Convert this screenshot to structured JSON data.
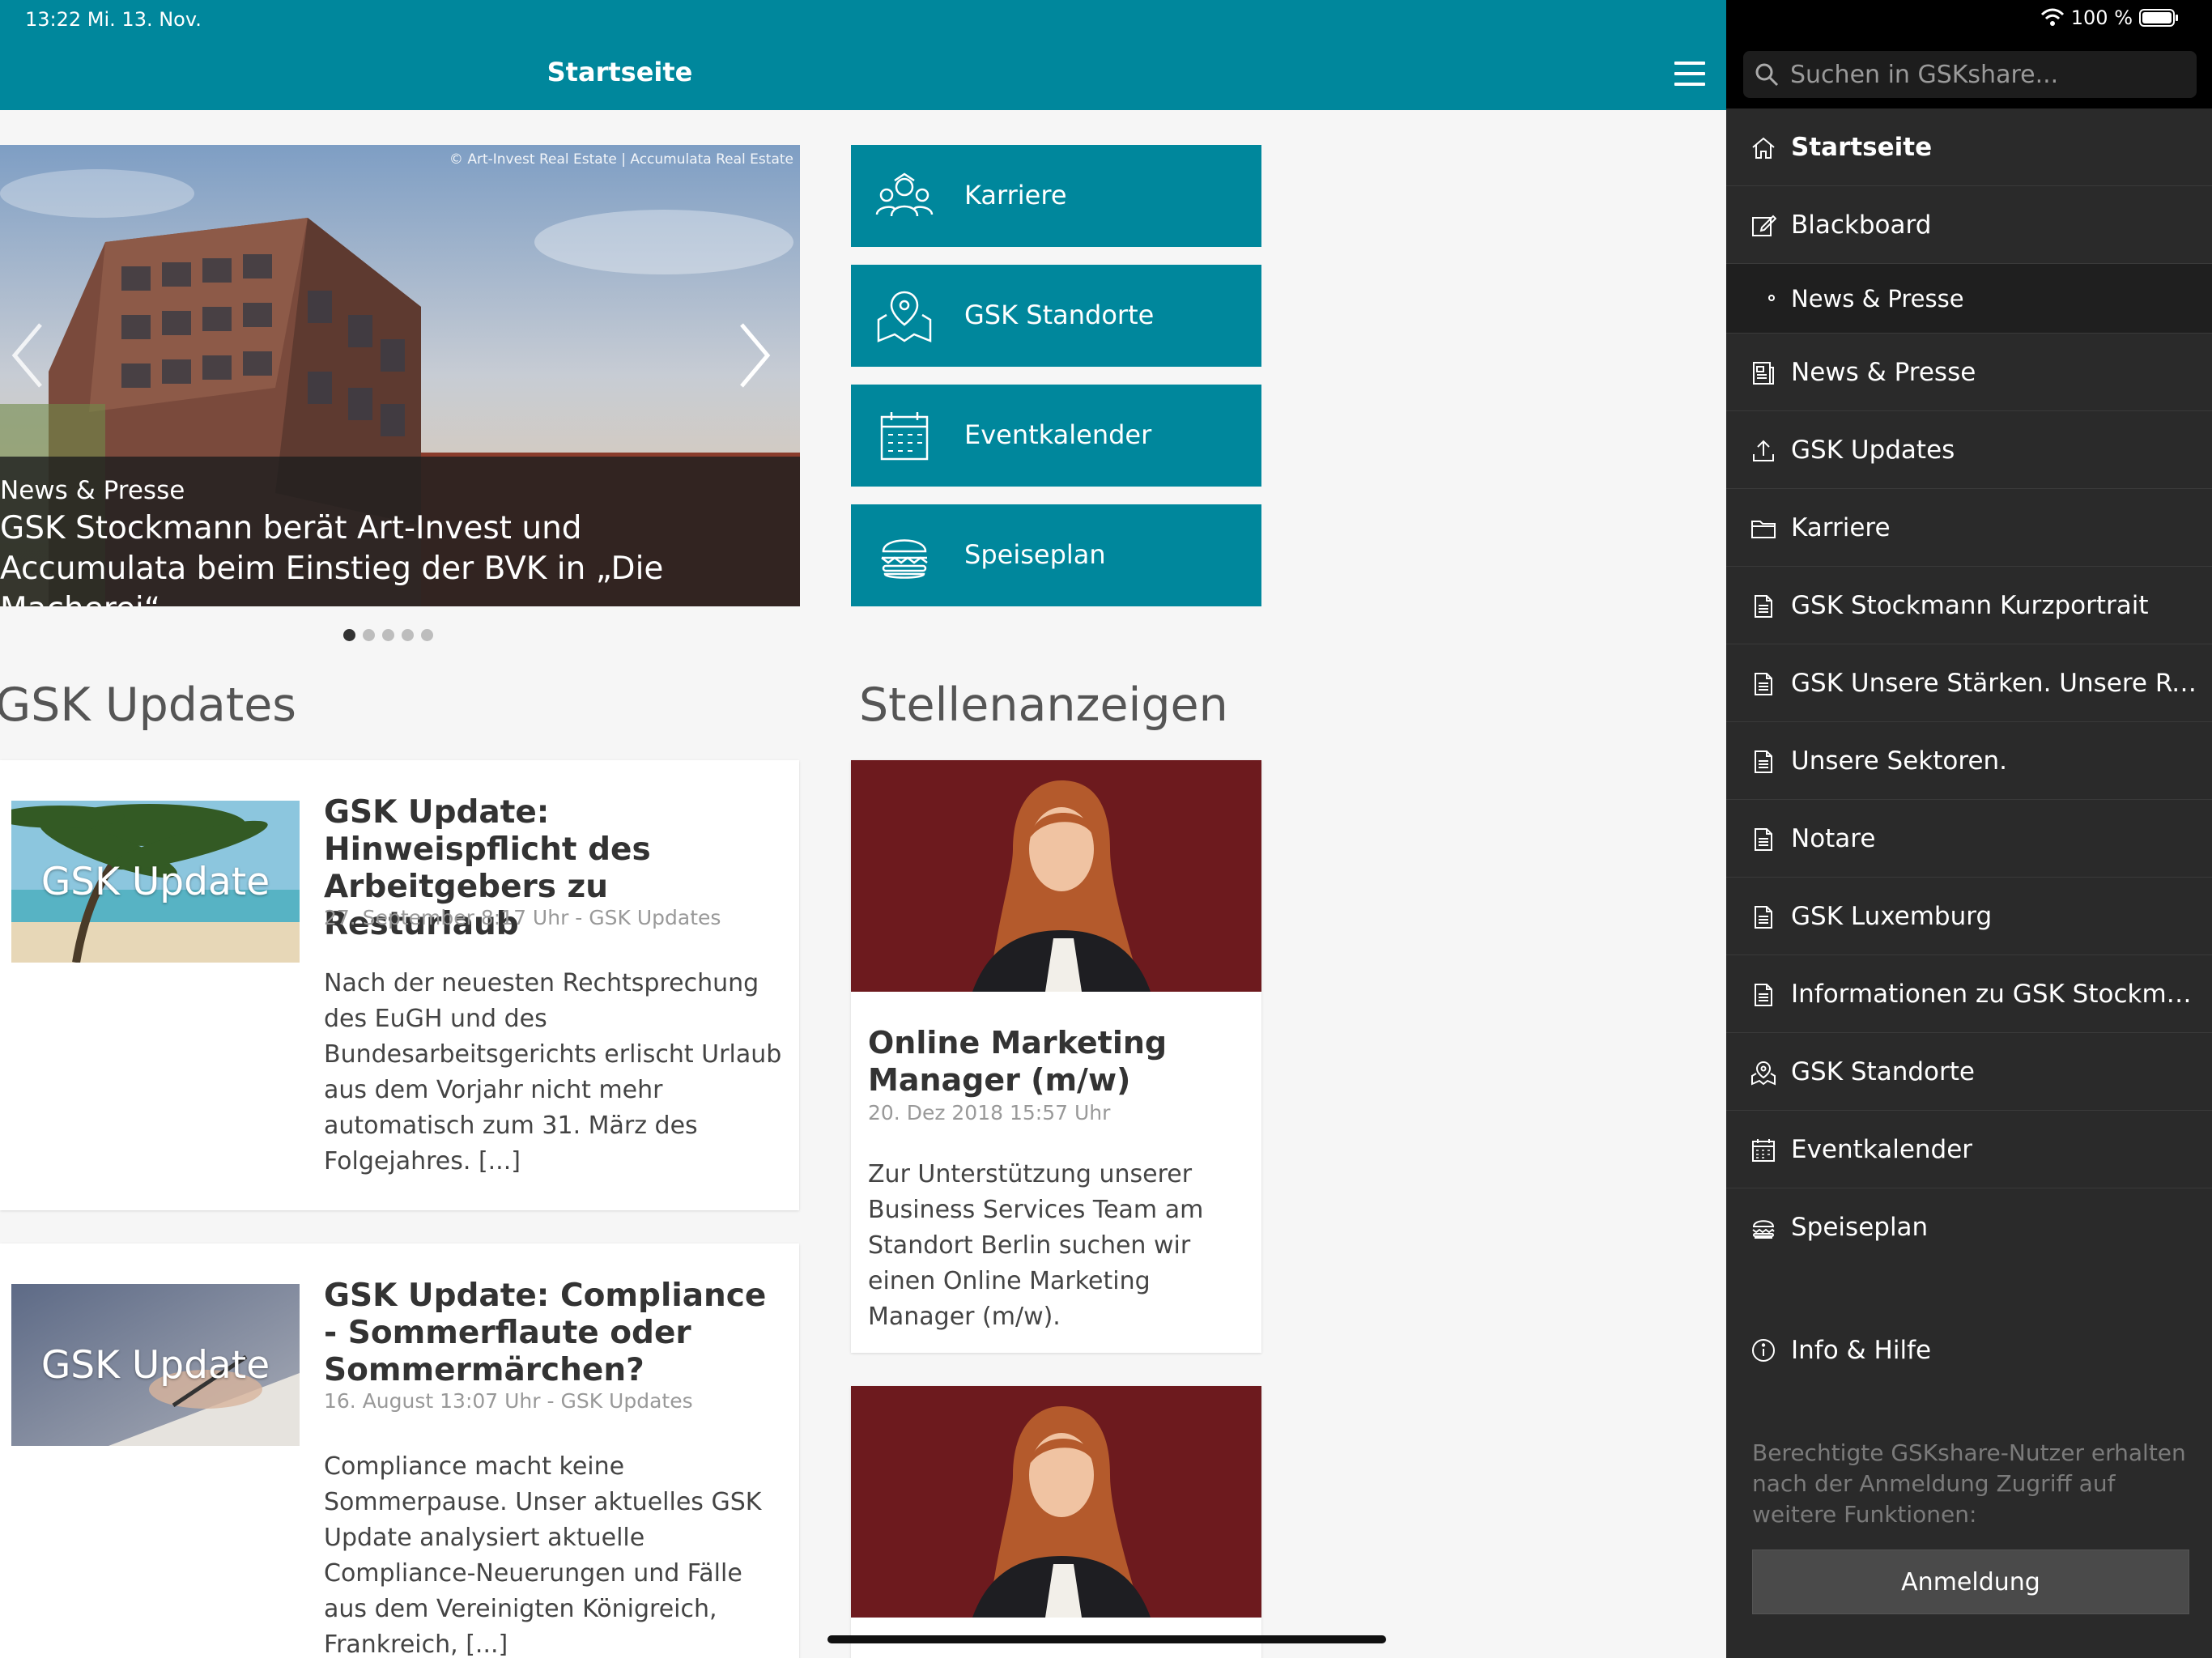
{
  "status": {
    "time_date": "13:22   Mi. 13. Nov.",
    "battery": "100 %"
  },
  "header": {
    "title": "Startseite"
  },
  "carousel": {
    "credit": "© Art-Invest Real Estate | Accumulata Real Estate",
    "category": "News & Presse",
    "headline": "GSK Stockmann berät Art-Invest und Accumulata beim Einstieg der BVK in „Die Macherei“",
    "slide_count": 5,
    "active_slide": 1
  },
  "tiles": [
    {
      "label": "Karriere",
      "icon": "career-icon"
    },
    {
      "label": "GSK Standorte",
      "icon": "map-pin-icon"
    },
    {
      "label": "Eventkalender",
      "icon": "calendar-icon"
    },
    {
      "label": "Speiseplan",
      "icon": "burger-icon"
    }
  ],
  "sections": {
    "updates_title": "GSK Updates",
    "jobs_title": "Stellenanzeigen"
  },
  "updates": [
    {
      "thumb_label": "GSK Update",
      "title": "GSK Update: Hinweispflicht des Arbeitgebers zu Resturlaub",
      "meta": "27. September 8:17 Uhr - GSK Updates",
      "body": "Nach der neuesten Rechtsprechung des EuGH und des Bundesarbeitsgerichts erlischt Urlaub aus dem Vorjahr nicht mehr automatisch zum 31. März des Folgejahres. [...]"
    },
    {
      "thumb_label": "GSK Update",
      "title": "GSK Update: Compliance - Sommerflaute oder Sommermärchen?",
      "meta": "16. August 13:07 Uhr - GSK Updates",
      "body": "Compliance macht keine Sommerpause. Unser aktuelles GSK Update analysiert aktuelle Compliance-Neuerungen und Fälle aus dem Vereinigten Königreich, Frankreich, [...]"
    }
  ],
  "jobs": [
    {
      "title": "Online Marketing Manager (m/w)",
      "date": "20. Dez 2018 15:57 Uhr",
      "body": "Zur Unterstützung unserer Business Services Team am Standort Berlin suchen wir einen Online Marketing Manager (m/w)."
    }
  ],
  "sidebar": {
    "search_placeholder": "Suchen in GSKshare...",
    "items": [
      {
        "label": "Startseite",
        "icon": "home-icon"
      },
      {
        "label": "Blackboard",
        "icon": "edit-icon"
      },
      {
        "label": "News & Presse",
        "icon": "bullet"
      },
      {
        "label": "News & Presse",
        "icon": "newspaper-icon"
      },
      {
        "label": "GSK Updates",
        "icon": "upload-icon"
      },
      {
        "label": "Karriere",
        "icon": "folder-icon"
      },
      {
        "label": "GSK Stockmann Kurzportrait",
        "icon": "document-icon"
      },
      {
        "label": "GSK Unsere Stärken. Unsere Referenzen.",
        "icon": "document-icon"
      },
      {
        "label": "Unsere Sektoren.",
        "icon": "document-icon"
      },
      {
        "label": "Notare",
        "icon": "document-icon"
      },
      {
        "label": "GSK Luxemburg",
        "icon": "document-icon"
      },
      {
        "label": "Informationen zu GSK Stockmann - ...",
        "icon": "document-icon"
      },
      {
        "label": "GSK Standorte",
        "icon": "map-pin-icon"
      },
      {
        "label": "Eventkalender",
        "icon": "calendar-icon"
      },
      {
        "label": "Speiseplan",
        "icon": "burger-icon"
      }
    ],
    "info_label": "Info & Hilfe",
    "login_note": "Berechtigte GSKshare-Nutzer erhalten nach der Anmeldung Zugriff auf weitere Funktionen:",
    "login_button": "Anmeldung"
  },
  "colors": {
    "brand_teal": "#00879c",
    "sidebar_bg": "#2a2a2a",
    "job_photo_bg": "#6d1a1e"
  }
}
